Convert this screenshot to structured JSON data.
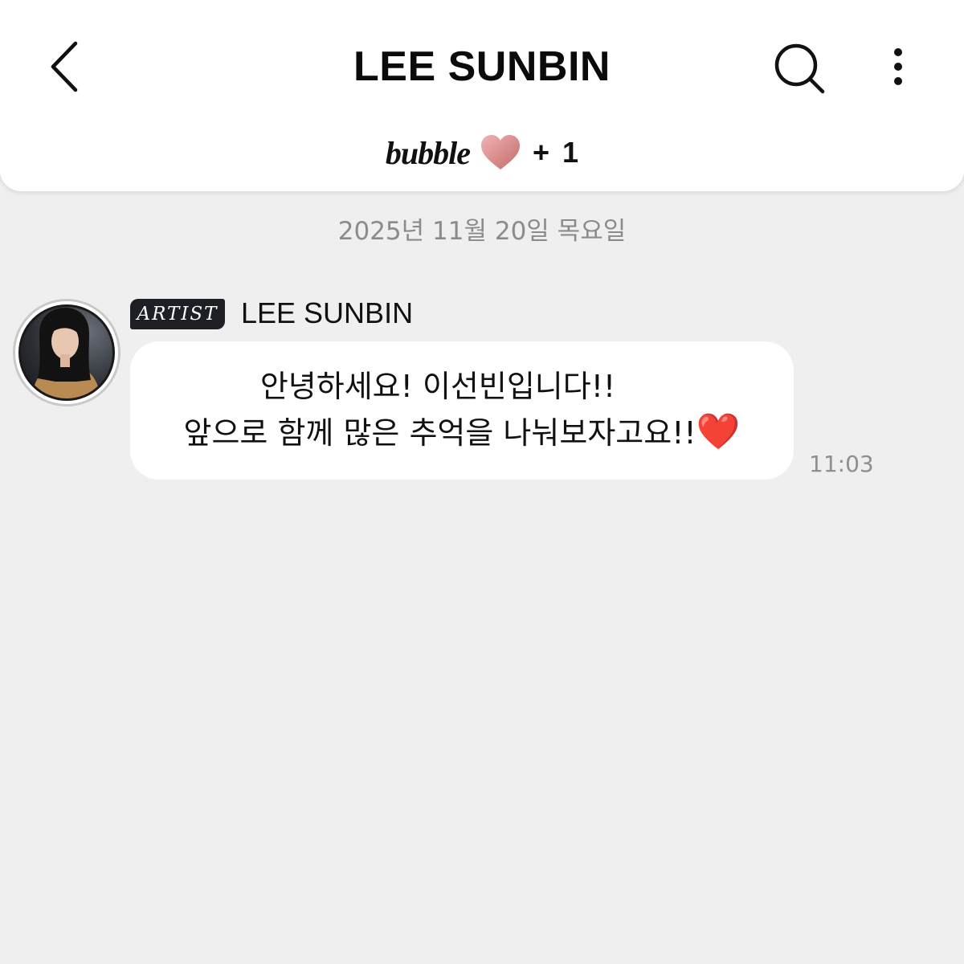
{
  "header": {
    "title": "LEE SUNBIN",
    "back_icon": "chevron-left-icon",
    "search_icon": "search-icon",
    "menu_icon": "more-vertical-icon",
    "subscription": {
      "logo_text": "bubble",
      "heart_icon": "heart-icon",
      "count_text": "+ 1"
    }
  },
  "chat": {
    "date": "2025년 11월 20일 목요일",
    "messages": [
      {
        "badge": "ARTIST",
        "sender": "LEE SUNBIN",
        "lines": [
          "안녕하세요! 이선빈입니다!!",
          "앞으로 함께 많은 추억을 나눠보자고요!!"
        ],
        "emoji": "❤️",
        "time": "11:03"
      }
    ]
  },
  "colors": {
    "background": "#efefef",
    "header_bg": "#ffffff",
    "bubble_bg": "#ffffff",
    "text": "#111111",
    "muted": "#8b8b8b",
    "badge_bg": "#1d1f24",
    "heart_red": "#e0142a",
    "bubble_heart": "#d98c8c"
  }
}
